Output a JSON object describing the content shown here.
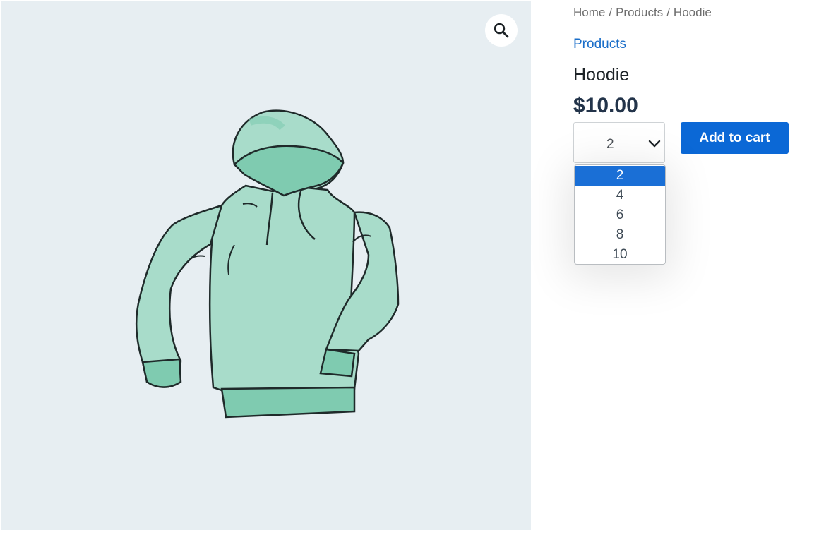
{
  "gallery": {
    "zoom_icon": "magnifier-icon",
    "image_subject": "hoodie-illustration",
    "colors": {
      "background": "#e7eef2",
      "hoodie_fill": "#a8dcca",
      "hoodie_shade": "#7fcbb0",
      "outline": "#1f2a2a"
    }
  },
  "breadcrumb": {
    "items": [
      "Home",
      "Products",
      "Hoodie"
    ],
    "separator": "/"
  },
  "category_link": "Products",
  "product": {
    "title": "Hoodie",
    "price": "$10.00"
  },
  "quantity": {
    "selected": "2",
    "options": [
      "2",
      "4",
      "6",
      "8",
      "10"
    ],
    "chevron_icon": "chevron-down-icon"
  },
  "add_to_cart": {
    "label": "Add to cart",
    "color": "#0b68d6"
  },
  "accent_color": "#1a6ec9"
}
